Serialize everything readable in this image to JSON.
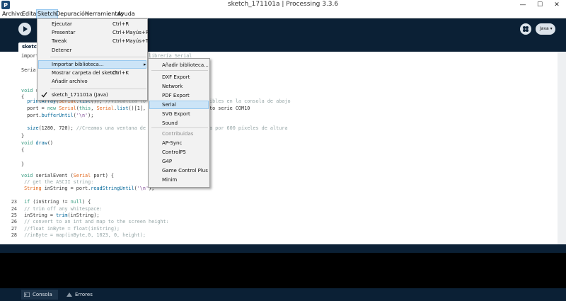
{
  "window": {
    "title": "sketch_171101a | Processing 3.3.6",
    "minimize": "—",
    "maximize": "☐",
    "close": "✕"
  },
  "menubar": {
    "items": [
      "Archivo",
      "Editar",
      "Sketch",
      "Depuración",
      "Herramientas",
      "Ayuda"
    ]
  },
  "toolbar": {
    "mode_label": "Java ▾"
  },
  "tab": {
    "label": "sketc"
  },
  "editor": {
    "lines": [
      {
        "n": "",
        "text": "import"
      },
      {
        "n": "",
        "text": ""
      },
      {
        "n": "",
        "text": "Seria"
      },
      {
        "n": "",
        "text": ""
      },
      {
        "n": "",
        "text": "void s"
      },
      {
        "n": "",
        "text": "{"
      },
      {
        "n": "",
        "text": "  printArray(Serial.list()); //Visualiza lo"
      },
      {
        "n": "",
        "text": "  port = new Serial(this, Serial.list()[1],"
      },
      {
        "n": "",
        "text": "  port.bufferUntil('\\n');"
      },
      {
        "n": "",
        "text": ""
      },
      {
        "n": "",
        "text": "  size(1280, 720); //Creamos una ventana de"
      },
      {
        "n": "",
        "text": "}"
      },
      {
        "n": "",
        "text": "void draw()"
      },
      {
        "n": "",
        "text": "{"
      },
      {
        "n": "",
        "text": ""
      },
      {
        "n": "",
        "text": "}"
      },
      {
        "n": "",
        "text": ""
      },
      {
        "n": "",
        "text": "void serialEvent (Serial port) {"
      },
      {
        "n": "",
        "text": " // get the ASCII string:"
      },
      {
        "n": "",
        "text": " String inString = port.readStringUntil('\\n');"
      },
      {
        "n": "",
        "text": ""
      },
      {
        "n": "23",
        "text": " if (inString != null) {"
      },
      {
        "n": "24",
        "text": " // trim off any whitespace:"
      },
      {
        "n": "25",
        "text": " inString = trim(inString);"
      },
      {
        "n": "26",
        "text": " // convert to an int and map to the screen height:"
      },
      {
        "n": "27",
        "text": " //float inByte = float(inString);"
      },
      {
        "n": "28",
        "text": " //inByte = map(inByte,0, 1023, 0, height);"
      }
    ],
    "behind_menu_texts": {
      "import_tail": "librería Serial",
      "print_tail": "ibles en la consola de abajo",
      "port_tail": "to serie COM10",
      "size_tail": "a por 600 píxeles de altura"
    }
  },
  "sketch_menu": {
    "items": [
      {
        "label": "Ejecutar",
        "shortcut": "Ctrl+R"
      },
      {
        "label": "Presentar",
        "shortcut": "Ctrl+Mayús+R"
      },
      {
        "label": "Tweak",
        "shortcut": "Ctrl+Mayús+T"
      },
      {
        "label": "Detener",
        "shortcut": ""
      },
      {
        "label": "Importar biblioteca...",
        "shortcut": "▸"
      },
      {
        "label": "Mostrar carpeta del sketch",
        "shortcut": "Ctrl+K"
      },
      {
        "label": "Añadir archivo",
        "shortcut": ""
      },
      {
        "label": "sketch_171101a (Java)",
        "shortcut": ""
      }
    ]
  },
  "library_menu": {
    "items": [
      {
        "label": "Añadir biblioteca...",
        "disabled": false
      },
      {
        "label": "DXF Export",
        "disabled": false
      },
      {
        "label": "Network",
        "disabled": false
      },
      {
        "label": "PDF Export",
        "disabled": false
      },
      {
        "label": "Serial",
        "disabled": false
      },
      {
        "label": "SVG Export",
        "disabled": false
      },
      {
        "label": "Sound",
        "disabled": false
      },
      {
        "label": "Contribuidas",
        "disabled": true
      },
      {
        "label": "AP-Sync",
        "disabled": false
      },
      {
        "label": "ControlP5",
        "disabled": false
      },
      {
        "label": "G4P",
        "disabled": false
      },
      {
        "label": "Game Control Plus",
        "disabled": false
      },
      {
        "label": "Minim",
        "disabled": false
      }
    ]
  },
  "footer": {
    "console_label": "Consola",
    "errors_label": "Errores"
  },
  "colors": {
    "ide_dark": "#0b2035",
    "menu_highlight": "#cce4f7"
  }
}
